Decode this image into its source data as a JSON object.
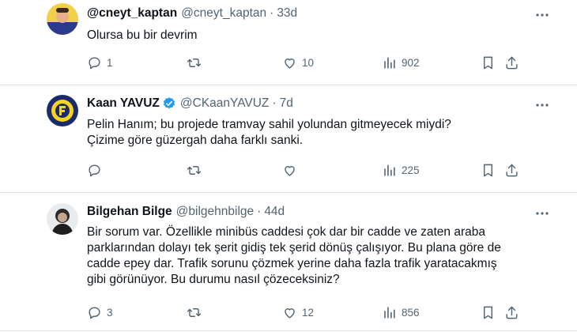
{
  "tweets": [
    {
      "name": "@cneyt_kaptan",
      "handle": "@cneyt_kaptan",
      "age": "33d",
      "text": [
        "Olursa bu bir devrim"
      ],
      "replies": "1",
      "retweets": "",
      "likes": "10",
      "views": "902",
      "verified": false
    },
    {
      "name": "Kaan YAVUZ",
      "handle": "@CKaanYAVUZ",
      "age": "7d",
      "text": [
        "Pelin Hanım; bu projede tramvay sahil yolundan gitmeyecek miydi?",
        "Çizime göre güzergah daha farklı sanki."
      ],
      "replies": "",
      "retweets": "",
      "likes": "",
      "views": "225",
      "verified": true
    },
    {
      "name": "Bilgehan Bilge",
      "handle": "@bilgehnbilge",
      "age": "44d",
      "text": [
        "Bir sorum var. Özellikle minibüs caddesi çok dar bir cadde ve zaten araba",
        "parklarından dolayı tek şerit gidiş tek şerid dönüş çalışıyor. Bu plana göre de",
        "cadde epey dar. Trafik sorunu çözmek yerine daha fazla trafik yaratacakmış",
        "gibi görünüyor. Bu durumu nasıl çözeceksiniz?"
      ],
      "replies": "3",
      "retweets": "",
      "likes": "12",
      "views": "856",
      "verified": false
    }
  ],
  "colors": {
    "text": "#0f1419",
    "secondary": "#536471",
    "divider": "#e1e6ea",
    "verified": "#1d9bf0"
  },
  "icons": [
    "reply-icon",
    "retweet-icon",
    "like-icon",
    "views-icon",
    "bookmark-icon",
    "share-icon",
    "more-icon",
    "verified-badge-icon"
  ]
}
